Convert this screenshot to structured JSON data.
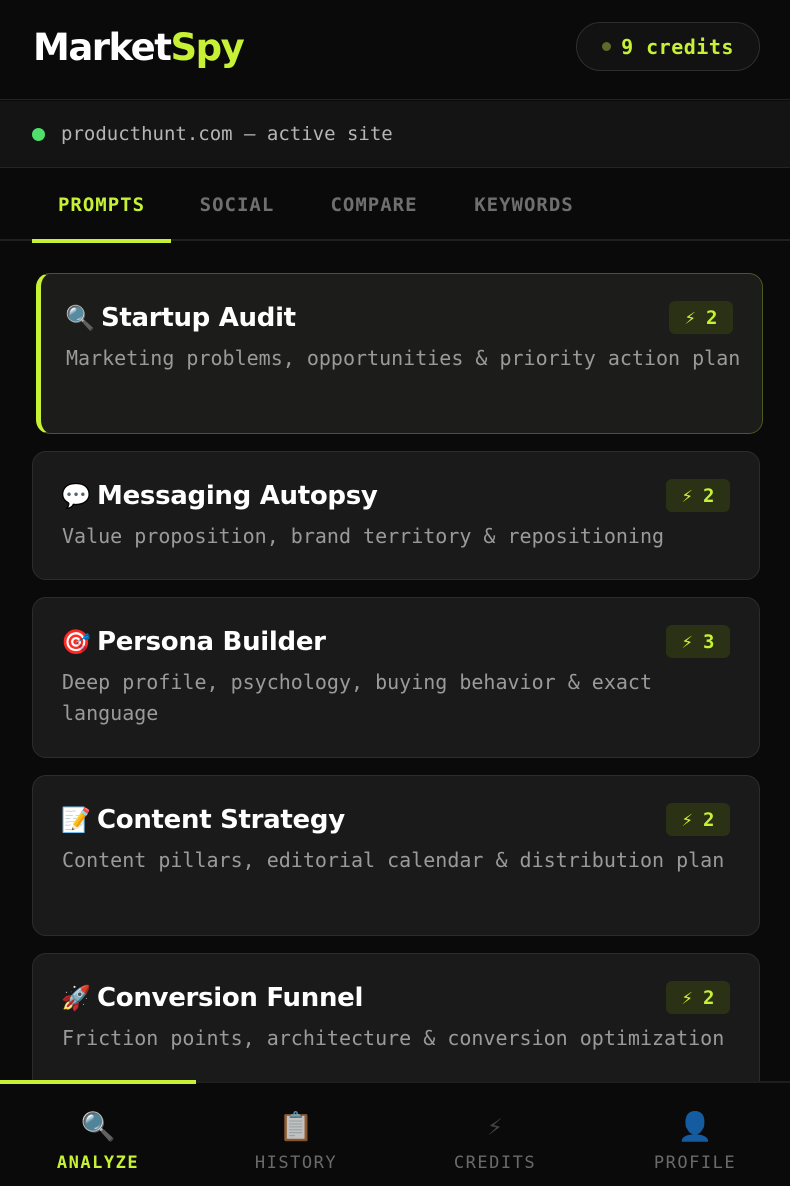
{
  "header": {
    "logo_part1": "Market",
    "logo_part2": "Spy",
    "credits_label": "9 credits"
  },
  "site": {
    "label": "producthunt.com — active site"
  },
  "tabs": [
    {
      "label": "PROMPTS",
      "active": true
    },
    {
      "label": "SOCIAL",
      "active": false
    },
    {
      "label": "COMPARE",
      "active": false
    },
    {
      "label": "KEYWORDS",
      "active": false
    }
  ],
  "prompts": [
    {
      "emoji": "🔍",
      "icon": "magnifier-icon",
      "title": "Startup Audit",
      "description": "Marketing problems, opportunities & priority action plan",
      "cost": "2",
      "selected": true
    },
    {
      "emoji": "💬",
      "icon": "speech-bubble-icon",
      "title": "Messaging Autopsy",
      "description": "Value proposition, brand territory & repositioning",
      "cost": "2",
      "selected": false
    },
    {
      "emoji": "🎯",
      "icon": "target-icon",
      "title": "Persona Builder",
      "description": "Deep profile, psychology, buying behavior & exact language",
      "cost": "3",
      "selected": false
    },
    {
      "emoji": "📝",
      "icon": "memo-icon",
      "title": "Content Strategy",
      "description": "Content pillars, editorial calendar & distribution plan",
      "cost": "2",
      "selected": false
    },
    {
      "emoji": "🚀",
      "icon": "rocket-icon",
      "title": "Conversion Funnel",
      "description": "Friction points, architecture & conversion optimization",
      "cost": "2",
      "selected": false
    }
  ],
  "bolt_glyph": "⚡",
  "bottom_nav": [
    {
      "label": "ANALYZE",
      "icon": "magnifier-icon",
      "glyph": "🔍",
      "active": true
    },
    {
      "label": "HISTORY",
      "icon": "clipboard-icon",
      "glyph": "📋",
      "active": false
    },
    {
      "label": "CREDITS",
      "icon": "lightning-icon",
      "glyph": "⚡",
      "active": false
    },
    {
      "label": "PROFILE",
      "icon": "user-icon",
      "glyph": "👤",
      "active": false
    }
  ],
  "colors": {
    "accent": "#c6f135",
    "background": "#0a0a0a",
    "card": "#1a1a1a",
    "site_status": "#4ee06b"
  }
}
